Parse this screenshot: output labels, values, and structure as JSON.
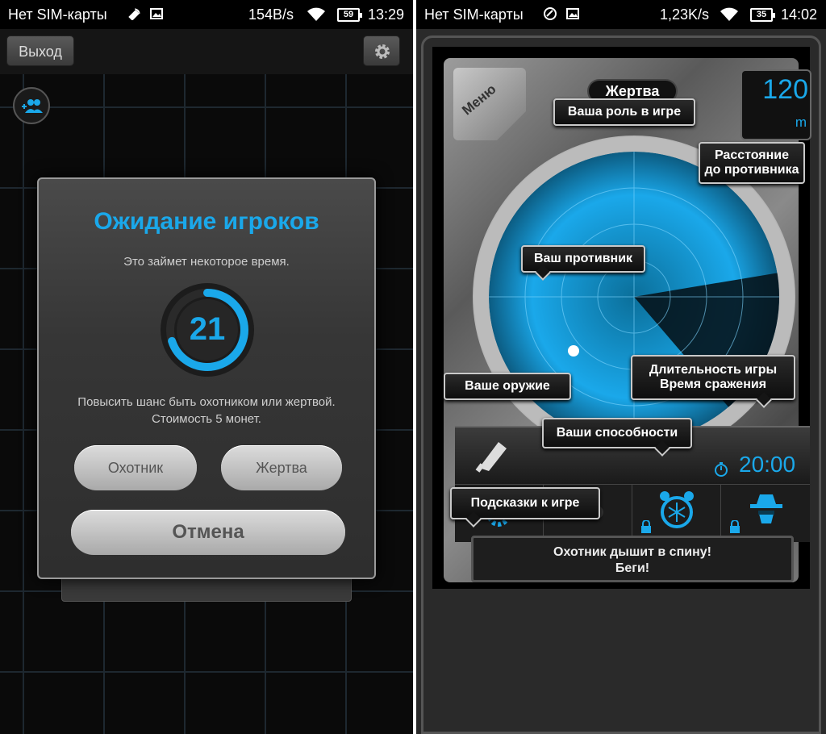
{
  "left": {
    "status_bar": {
      "carrier": "Нет SIM-карты",
      "speed": "154B/s",
      "battery": "59",
      "time": "13:29"
    },
    "top_bar": {
      "exit_label": "Выход"
    },
    "dialog": {
      "title": "Ожидание игроков",
      "subtitle": "Это займет некоторое время.",
      "countdown": "21",
      "countdown_progress": 0.7,
      "chance_text_line1": "Повысить шанс быть охотником или жертвой.",
      "chance_text_line2": "Стоимость 5 монет.",
      "hunter_label": "Охотник",
      "victim_label": "Жертва",
      "cancel_label": "Отмена"
    },
    "colors": {
      "accent": "#1aa8ea"
    }
  },
  "right": {
    "status_bar": {
      "carrier": "Нет SIM-карты",
      "speed": "1,23K/s",
      "battery": "35",
      "time": "14:02"
    },
    "game": {
      "menu_label": "Меню",
      "role": "Жертва",
      "distance_value": "120",
      "distance_unit": "m",
      "duration": "20:00",
      "message_line1": "Охотник дышит в спину!",
      "message_line2": "Беги!"
    },
    "tooltips": {
      "role": "Ваша роль в игре",
      "distance_line1": "Расстояние",
      "distance_line2": "до противника",
      "opponent": "Ваш противник",
      "weapon": "Ваше оружие",
      "duration_line1": "Длительность игры",
      "duration_line2": "Время сражения",
      "abilities": "Ваши способности",
      "hints": "Подсказки к игре"
    },
    "abilities": [
      {
        "icon": "gear-ability-icon",
        "locked": false
      },
      {
        "icon": "binoculars-icon",
        "locked": false
      },
      {
        "icon": "frozen-alarm-clock-icon",
        "locked": true
      },
      {
        "icon": "spy-hat-icon",
        "locked": true
      }
    ],
    "colors": {
      "radar": "#1aa8ea"
    }
  }
}
